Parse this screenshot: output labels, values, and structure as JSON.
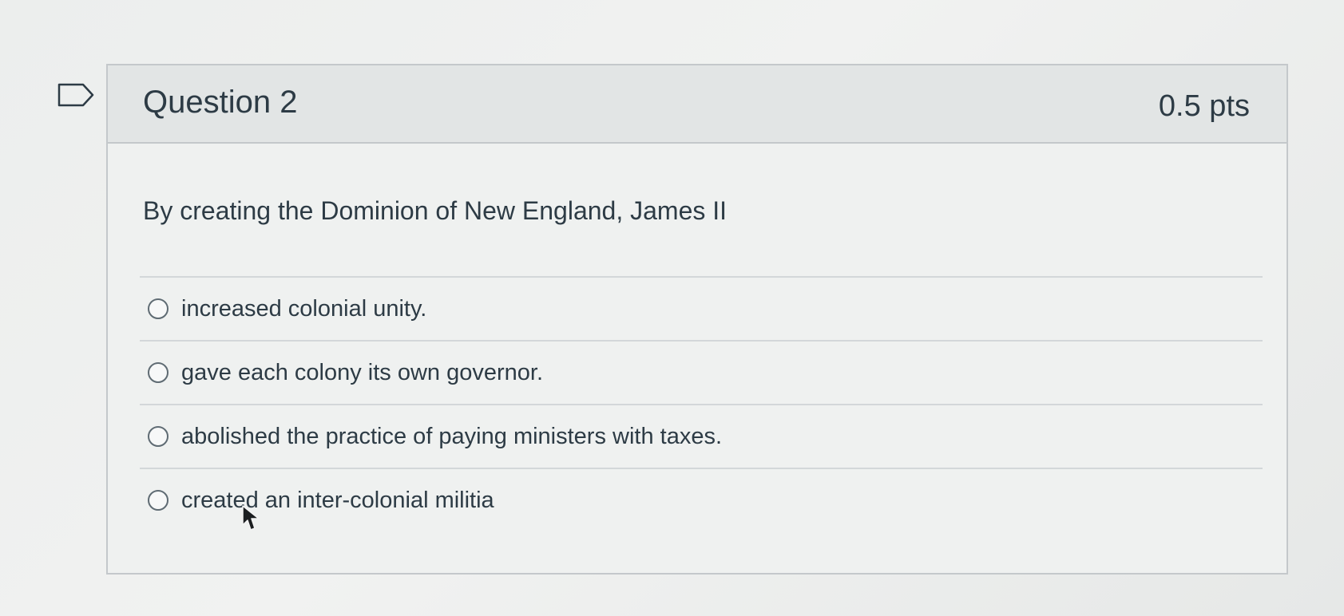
{
  "question": {
    "title": "Question 2",
    "points": "0.5 pts",
    "text": "By creating the Dominion of New England, James II",
    "answers": [
      {
        "label": "increased colonial unity.",
        "selected": false
      },
      {
        "label": "gave each colony its own governor.",
        "selected": false
      },
      {
        "label": "abolished the practice of paying ministers with taxes.",
        "selected": false
      },
      {
        "label": "created an inter-colonial militia",
        "selected": false
      }
    ]
  },
  "icons": {
    "flag": "flag-question-icon",
    "cursor": "mouse-pointer-icon"
  },
  "colors": {
    "text": "#2d3b45",
    "header_bg": "#e2e5e5",
    "border": "#c4c8cb"
  }
}
